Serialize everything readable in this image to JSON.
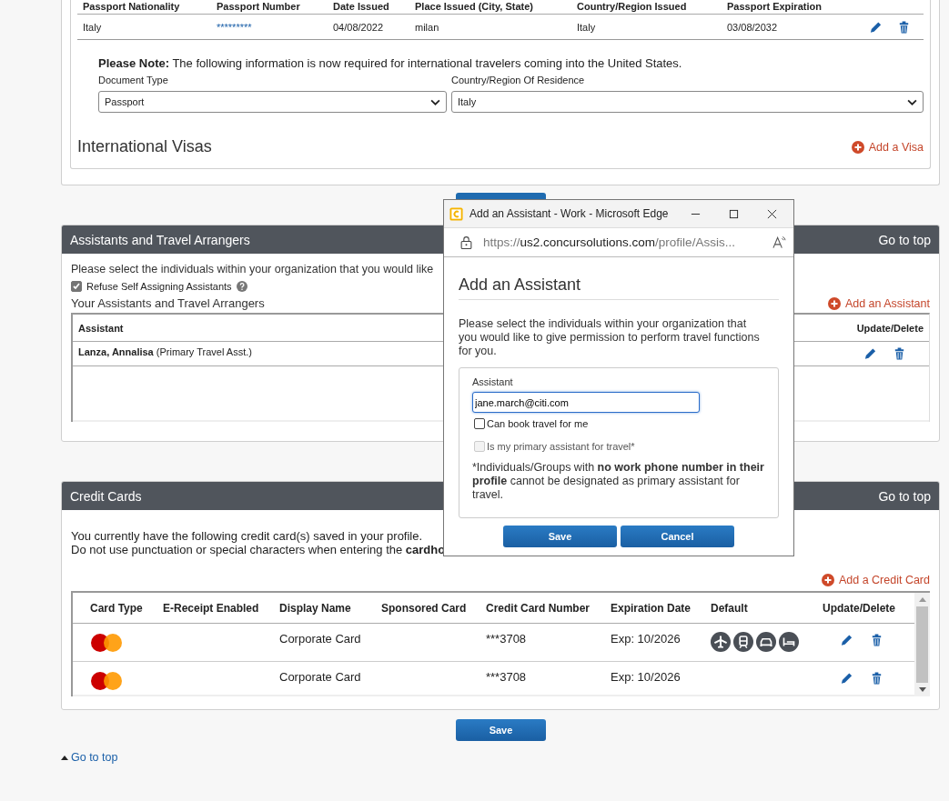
{
  "passport": {
    "columns": [
      "Passport Nationality",
      "Passport Number",
      "Date Issued",
      "Place Issued (City, State)",
      "Country/Region Issued",
      "Passport Expiration"
    ],
    "row": [
      "Italy",
      "*********",
      "04/08/2022",
      "milan",
      "Italy",
      "03/08/2032"
    ],
    "note": "**Please Note:** The following information is now required for international travelers coming into the United States.",
    "document_type": {
      "label": "Document Type",
      "value": "Passport"
    },
    "residence": {
      "label": "Country/Region Of Residence",
      "value": "Italy"
    }
  },
  "visas": {
    "title": "International Visas",
    "add": "Add a Visa"
  },
  "assistants": {
    "title": "Assistants and Travel Arrangers",
    "go_to_top": "Go to top",
    "intro": "Please select the individuals within your organization that you would like",
    "refuse": {
      "label": "Refuse Self Assigning Assistants",
      "checked": true
    },
    "list_title": "Your Assistants and Travel Arrangers",
    "add": "Add an Assistant",
    "columns": [
      "Assistant",
      "Update/Delete"
    ],
    "rows": [
      {
        "name": "Lanza, Annalisa",
        "note": "(Primary Travel Asst.)"
      }
    ]
  },
  "credit_cards": {
    "title": "Credit Cards",
    "go_to_top": "Go to top",
    "intro": [
      "You currently have the following credit card(s) saved in your profile.",
      "Do not use punctuation or special characters when entering the **cardho**"
    ],
    "add": "Add a Credit Card",
    "columns": [
      "Card Type",
      "E-Receipt Enabled",
      "Display Name",
      "Sponsored Card",
      "Credit Card Number",
      "Expiration Date",
      "Default",
      "Update/Delete"
    ],
    "rows": [
      {
        "display_name": "Corporate Card",
        "number": "***3708",
        "expiration": "Exp: 10/2026",
        "default": true
      },
      {
        "display_name": "Corporate Card",
        "number": "***3708",
        "expiration": "Exp: 10/2026",
        "default": false
      }
    ]
  },
  "save": "Save",
  "go_to_top": "Go to top",
  "popup": {
    "title": "Add an Assistant - Work - Microsoft Edge",
    "url": {
      "scheme": "https://",
      "host": "us2.concursolutions.com",
      "path": "/profile/Assis..."
    },
    "heading": "Add an Assistant",
    "intro": "Please select the individuals within your organization that you would like to give permission to perform travel functions for you.",
    "field": {
      "label": "Assistant",
      "value": "jane.march@citi.com"
    },
    "options": [
      {
        "label": "Can book travel for me",
        "checked": false,
        "disabled": false
      },
      {
        "label": "Is my primary assistant for travel*",
        "checked": false,
        "disabled": true
      }
    ],
    "footnote": "*Individuals/Groups with **no work phone number in their profile** cannot be designated as primary assistant for travel.",
    "buttons": [
      "Save",
      "Cancel"
    ]
  }
}
